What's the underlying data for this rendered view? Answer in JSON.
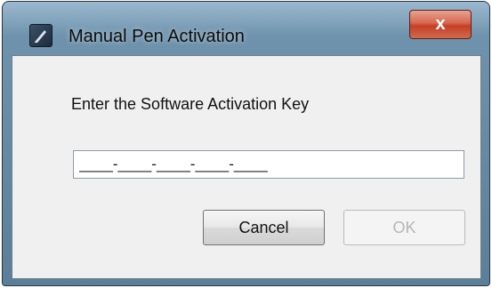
{
  "dialog": {
    "title": "Manual Pen Activation",
    "close_label": "x",
    "prompt": "Enter the Software Activation Key",
    "key_value": "____-____-____-____-____",
    "cancel_label": "Cancel",
    "ok_label": "OK",
    "ok_enabled": false
  },
  "icons": {
    "app": "pen-icon",
    "close": "close-icon"
  },
  "colors": {
    "close_button": "#c44026",
    "frame": "#6f93ad",
    "client_bg": "#f0f0f0",
    "disabled_text": "#b6b6b6"
  }
}
